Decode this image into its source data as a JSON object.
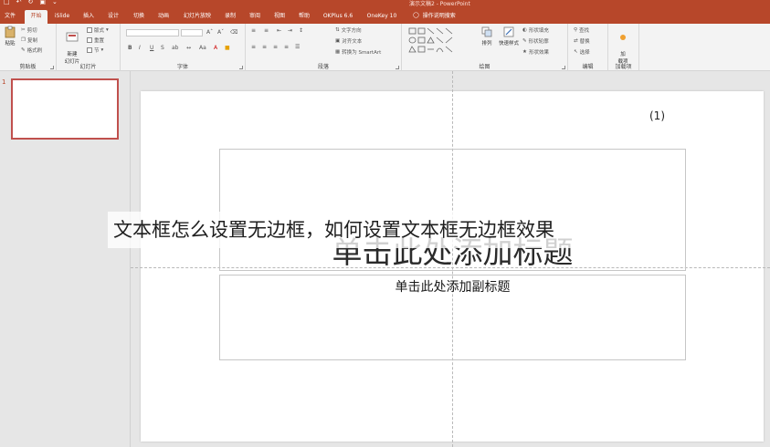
{
  "titlebar": {
    "doc_title": "演示文稿2 - PowerPoint",
    "qat": [
      "save-icon",
      "undo-icon",
      "redo-icon",
      "present-icon",
      "customize-icon"
    ],
    "colors": {
      "brand": "#b7472a"
    }
  },
  "tabs": [
    {
      "label": "文件"
    },
    {
      "label": "开始"
    },
    {
      "label": "iSlide"
    },
    {
      "label": "插入"
    },
    {
      "label": "设计"
    },
    {
      "label": "切换"
    },
    {
      "label": "动画"
    },
    {
      "label": "幻灯片放映"
    },
    {
      "label": "录制"
    },
    {
      "label": "审阅"
    },
    {
      "label": "视图"
    },
    {
      "label": "帮助"
    },
    {
      "label": "OKPlus 6.6"
    },
    {
      "label": "OneKey 10"
    }
  ],
  "tellme": "操作说明搜索",
  "ribbon": {
    "clipboard": {
      "label": "剪贴板",
      "paste": "粘贴",
      "cut": "剪切",
      "copy": "复制",
      "format_painter": "格式刷"
    },
    "slides": {
      "label": "幻灯片",
      "new_slide": "新建\n幻灯片",
      "layout": "版式",
      "reset": "重置",
      "section": "节"
    },
    "font": {
      "label": "字体",
      "font_name": "",
      "font_size": "",
      "bold": "B",
      "italic": "I",
      "underline": "U",
      "strike": "S",
      "shadow": "ab"
    },
    "paragraph": {
      "label": "段落",
      "text_direction": "文字方向",
      "align_text": "对齐文本",
      "smartart": "转换为 SmartArt"
    },
    "drawing": {
      "label": "绘图",
      "arrange": "排列",
      "quick_styles": "快速样式",
      "shape_fill": "形状填充",
      "shape_outline": "形状轮廓",
      "shape_effects": "形状效果"
    },
    "editing": {
      "label": "编辑",
      "find": "查找",
      "replace": "替换",
      "select": "选择"
    },
    "addins": {
      "label": "加载项",
      "btn": "加\n载项"
    }
  },
  "thumbnails": [
    {
      "number": "1"
    }
  ],
  "slide": {
    "page_marker": "(1)",
    "title_placeholder": "单击此处添加标题",
    "subtitle_placeholder": "单击此处添加副标题"
  },
  "caption": "文本框怎么设置无边框，如何设置文本框无边框效果"
}
